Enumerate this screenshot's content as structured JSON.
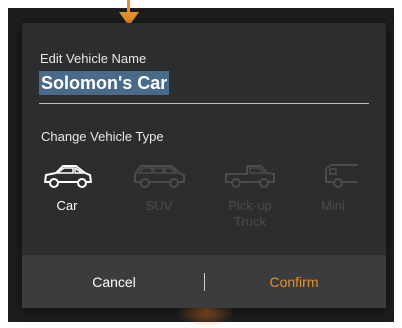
{
  "dialog": {
    "name_label": "Edit Vehicle Name",
    "name_value": "Solomon's Car",
    "type_label": "Change Vehicle Type",
    "vehicle_types": [
      {
        "label": "Car",
        "icon": "car-icon",
        "selected": true
      },
      {
        "label": "SUV",
        "icon": "suv-icon",
        "selected": false
      },
      {
        "label": "Pick-up Truck",
        "icon": "pickup-truck-icon",
        "selected": false
      },
      {
        "label": "Mini",
        "icon": "minivan-icon",
        "selected": false
      }
    ],
    "cancel_label": "Cancel",
    "confirm_label": "Confirm"
  },
  "colors": {
    "accent": "#e88f2a",
    "dialog_bg": "#2b2d2e",
    "footer_bg": "#3a3c3e",
    "selection": "#4a6a8a",
    "inactive": "#4a4c4d"
  }
}
